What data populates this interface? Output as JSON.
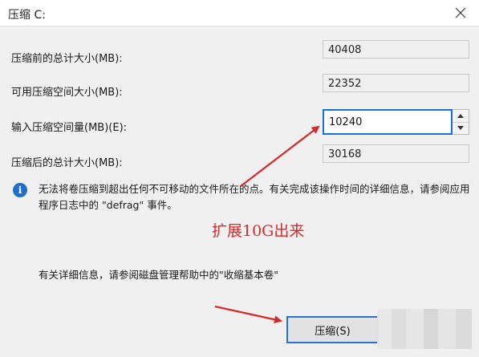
{
  "window": {
    "title": "压缩 C:"
  },
  "fields": {
    "total_before_label": "压缩前的总计大小(MB):",
    "total_before_value": "40408",
    "available_label": "可用压缩空间大小(MB):",
    "available_value": "22352",
    "input_label": "输入压缩空间量(MB)(E):",
    "input_value": "10240",
    "total_after_label": "压缩后的总计大小(MB):",
    "total_after_value": "30168"
  },
  "info": {
    "message": "无法将卷压缩到超出任何不可移动的文件所在的点。有关完成该操作时间的详细信息，请参阅应用程序日志中的 \"defrag\" 事件。",
    "help": "有关详细信息，请参阅磁盘管理帮助中的\"收缩基本卷\""
  },
  "annotation": {
    "text": "扩展10G出来",
    "color": "#d42a2a"
  },
  "buttons": {
    "shrink_label": "压缩(S)"
  },
  "icons": {
    "close": "close-icon",
    "info": "info-icon",
    "spin_up": "spin-up-icon",
    "spin_down": "spin-down-icon"
  },
  "colors": {
    "accent": "#1a6fd3",
    "dialog_bg": "#f0f0f0"
  }
}
